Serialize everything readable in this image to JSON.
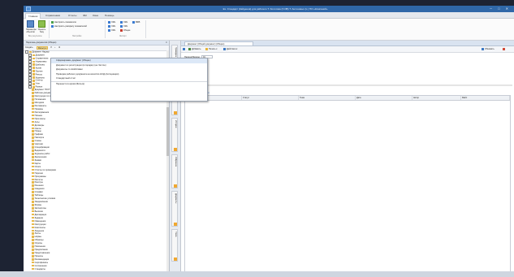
{
  "window": {
    "title": "Ex. Стандарт (Кайденов) для рабочего T. Золотова (Х.ИВ) T. Антоновых (L.) ПО «Компаний»"
  },
  "ribbon_tabs": [
    {
      "label": "Главная",
      "active": true
    },
    {
      "label": "Справочники"
    },
    {
      "label": "Отчеты"
    },
    {
      "label": "ЭМ"
    },
    {
      "label": "Окна"
    },
    {
      "label": "Помощь"
    }
  ],
  "ribbon": {
    "big_buttons": [
      {
        "label": "Параметры объектов",
        "color": "blue"
      },
      {
        "label": "Оценить базу",
        "color": "green"
      }
    ],
    "lines_col1": [
      "Настроить показатели",
      "Настроить раскрасу показателей"
    ],
    "lines_col2": [
      "XML",
      "XML",
      "XML"
    ],
    "lines_col3": [
      "XML",
      "XML",
      "Общее"
    ],
    "lines_col4": [
      "ВФВ"
    ],
    "group_labels": [
      "Все результаты",
      "Настройки",
      "Экспорт"
    ]
  },
  "left_panel": {
    "header": "Перечень документов (Общее)",
    "toolbar": {
      "new_label": "Создать",
      "filter_label": "Фильтр"
    },
    "tree": [
      "Документ Надзор",
      "Документ",
      "Справочники",
      "Нормативы",
      "Шаблоны",
      "Архив",
      "Прочее",
      "Реестр",
      "Журналы",
      "Отчёты",
      "Учет",
      "Разное",
      "Документ ГОСТ",
      "Рабочая документация (подраздел)",
      "Инструкции по охране труда",
      "Положения",
      "Методики",
      "Регламенты",
      "Приказы",
      "Распоряжения",
      "Письма",
      "Протоколы",
      "Акты",
      "Договоры",
      "Сметы",
      "Планы",
      "Графики",
      "Паспорта",
      "Схемы",
      "Чертежи",
      "Спецификации",
      "Ведомости",
      "Журналы работ",
      "Заключения",
      "Заявки",
      "Карты",
      "Описи",
      "Отчёты по проверкам",
      "Перечни",
      "Программы",
      "Расчеты",
      "Реестры",
      "Решения",
      "Сведения",
      "Справки",
      "Таблицы",
      "Технические условия",
      "Уведомления",
      "Формы",
      "Экспертизы",
      "Выписки",
      "Декларации",
      "Задания",
      "Извещения",
      "Инструкции",
      "Комплекты",
      "Лицензии",
      "Листы",
      "Нормы",
      "Образцы",
      "Опросы",
      "Пояснения",
      "Предписания",
      "Представления",
      "Проекты",
      "Рекомендации",
      "Сертификаты",
      "Соглашения",
      "Стандарты"
    ]
  },
  "dropdown": {
    "items": [
      {
        "label": "Сформировать документ (Общее)",
        "highlighted": true
      },
      {
        "label": "Документ из регистрации (в порядке) (не Чистое)"
      },
      {
        "label": "Документы со свойствами"
      },
      {
        "label": "Проверка рабочего документа на качество НСД (Ассоциация)"
      },
      {
        "label": "Стандартный отчет",
        "separator_after": true
      },
      {
        "label": "Перенести в архив (Фильтр)"
      }
    ]
  },
  "vertical_tabs": [
    "Проводник",
    "Закладки",
    "История",
    "Избранное",
    "Документы",
    "Поиск"
  ],
  "main": {
    "doc_tab": "Документ (Общий документ) (Общие)",
    "toolbar": {
      "save_label": "Сохранить",
      "add_label": "Добавить",
      "print_label": "Печать",
      "actions_label": "Действия",
      "refresh_label": "Обновить"
    },
    "filter_label": "Период/Период:",
    "filter_value": "01",
    "section_title": "Журнал",
    "section_link": "Журнал (Общий Журнал)",
    "columns": [
      "Рабочий номер",
      "Статус",
      "Тема",
      "Дата",
      "Автор",
      "Файл"
    ]
  },
  "colors": {
    "accent": "#2f67a8",
    "dropdown_highlight": "#dce8f7"
  }
}
